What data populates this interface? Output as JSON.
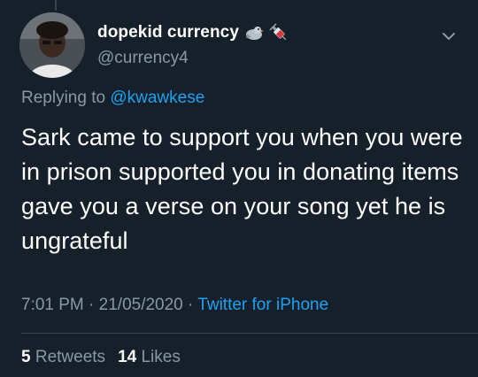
{
  "tweet": {
    "author": {
      "display_name": "dopekid currency",
      "handle": "@currency4",
      "emojis": [
        "pigeon-emoji",
        "syringe-emoji"
      ]
    },
    "replying_prefix": "Replying to",
    "replying_to": "@kwawkese",
    "text": "Sark came to support you when you were in prison supported you in donating items gave you a verse on your song yet he is ungrateful",
    "time": "7:01 PM",
    "date": "21/05/2020",
    "separator": "·",
    "source": "Twitter for iPhone",
    "retweets_count": "5",
    "retweets_label": "Retweets",
    "likes_count": "14",
    "likes_label": "Likes"
  },
  "colors": {
    "background": "#15202b",
    "text_primary": "#ffffff",
    "text_secondary": "#8899a6",
    "accent": "#1da1f2",
    "divider": "#38444d"
  }
}
